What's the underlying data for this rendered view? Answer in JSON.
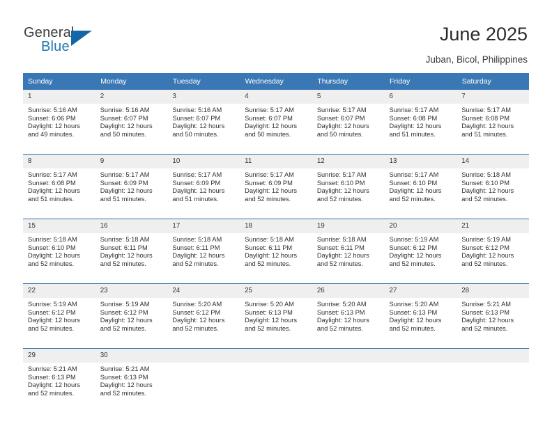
{
  "brand": {
    "name_top": "General",
    "name_bottom": "Blue",
    "accent_color": "#1167a8"
  },
  "header": {
    "title": "June 2025",
    "subtitle": "Juban, Bicol, Philippines"
  },
  "theme": {
    "header_bg": "#3a78b5",
    "week_divider": "#2f6da8",
    "daynum_bg": "#efefef"
  },
  "columns": [
    "Sunday",
    "Monday",
    "Tuesday",
    "Wednesday",
    "Thursday",
    "Friday",
    "Saturday"
  ],
  "labels": {
    "sunrise_prefix": "Sunrise:",
    "sunset_prefix": "Sunset:",
    "daylight_prefix": "Daylight:"
  },
  "weeks": [
    [
      {
        "day": "1",
        "sunrise": "Sunrise: 5:16 AM",
        "sunset": "Sunset: 6:06 PM",
        "daylight1": "Daylight: 12 hours",
        "daylight2": "and 49 minutes."
      },
      {
        "day": "2",
        "sunrise": "Sunrise: 5:16 AM",
        "sunset": "Sunset: 6:07 PM",
        "daylight1": "Daylight: 12 hours",
        "daylight2": "and 50 minutes."
      },
      {
        "day": "3",
        "sunrise": "Sunrise: 5:16 AM",
        "sunset": "Sunset: 6:07 PM",
        "daylight1": "Daylight: 12 hours",
        "daylight2": "and 50 minutes."
      },
      {
        "day": "4",
        "sunrise": "Sunrise: 5:17 AM",
        "sunset": "Sunset: 6:07 PM",
        "daylight1": "Daylight: 12 hours",
        "daylight2": "and 50 minutes."
      },
      {
        "day": "5",
        "sunrise": "Sunrise: 5:17 AM",
        "sunset": "Sunset: 6:07 PM",
        "daylight1": "Daylight: 12 hours",
        "daylight2": "and 50 minutes."
      },
      {
        "day": "6",
        "sunrise": "Sunrise: 5:17 AM",
        "sunset": "Sunset: 6:08 PM",
        "daylight1": "Daylight: 12 hours",
        "daylight2": "and 51 minutes."
      },
      {
        "day": "7",
        "sunrise": "Sunrise: 5:17 AM",
        "sunset": "Sunset: 6:08 PM",
        "daylight1": "Daylight: 12 hours",
        "daylight2": "and 51 minutes."
      }
    ],
    [
      {
        "day": "8",
        "sunrise": "Sunrise: 5:17 AM",
        "sunset": "Sunset: 6:08 PM",
        "daylight1": "Daylight: 12 hours",
        "daylight2": "and 51 minutes."
      },
      {
        "day": "9",
        "sunrise": "Sunrise: 5:17 AM",
        "sunset": "Sunset: 6:09 PM",
        "daylight1": "Daylight: 12 hours",
        "daylight2": "and 51 minutes."
      },
      {
        "day": "10",
        "sunrise": "Sunrise: 5:17 AM",
        "sunset": "Sunset: 6:09 PM",
        "daylight1": "Daylight: 12 hours",
        "daylight2": "and 51 minutes."
      },
      {
        "day": "11",
        "sunrise": "Sunrise: 5:17 AM",
        "sunset": "Sunset: 6:09 PM",
        "daylight1": "Daylight: 12 hours",
        "daylight2": "and 52 minutes."
      },
      {
        "day": "12",
        "sunrise": "Sunrise: 5:17 AM",
        "sunset": "Sunset: 6:10 PM",
        "daylight1": "Daylight: 12 hours",
        "daylight2": "and 52 minutes."
      },
      {
        "day": "13",
        "sunrise": "Sunrise: 5:17 AM",
        "sunset": "Sunset: 6:10 PM",
        "daylight1": "Daylight: 12 hours",
        "daylight2": "and 52 minutes."
      },
      {
        "day": "14",
        "sunrise": "Sunrise: 5:18 AM",
        "sunset": "Sunset: 6:10 PM",
        "daylight1": "Daylight: 12 hours",
        "daylight2": "and 52 minutes."
      }
    ],
    [
      {
        "day": "15",
        "sunrise": "Sunrise: 5:18 AM",
        "sunset": "Sunset: 6:10 PM",
        "daylight1": "Daylight: 12 hours",
        "daylight2": "and 52 minutes."
      },
      {
        "day": "16",
        "sunrise": "Sunrise: 5:18 AM",
        "sunset": "Sunset: 6:11 PM",
        "daylight1": "Daylight: 12 hours",
        "daylight2": "and 52 minutes."
      },
      {
        "day": "17",
        "sunrise": "Sunrise: 5:18 AM",
        "sunset": "Sunset: 6:11 PM",
        "daylight1": "Daylight: 12 hours",
        "daylight2": "and 52 minutes."
      },
      {
        "day": "18",
        "sunrise": "Sunrise: 5:18 AM",
        "sunset": "Sunset: 6:11 PM",
        "daylight1": "Daylight: 12 hours",
        "daylight2": "and 52 minutes."
      },
      {
        "day": "19",
        "sunrise": "Sunrise: 5:18 AM",
        "sunset": "Sunset: 6:11 PM",
        "daylight1": "Daylight: 12 hours",
        "daylight2": "and 52 minutes."
      },
      {
        "day": "20",
        "sunrise": "Sunrise: 5:19 AM",
        "sunset": "Sunset: 6:12 PM",
        "daylight1": "Daylight: 12 hours",
        "daylight2": "and 52 minutes."
      },
      {
        "day": "21",
        "sunrise": "Sunrise: 5:19 AM",
        "sunset": "Sunset: 6:12 PM",
        "daylight1": "Daylight: 12 hours",
        "daylight2": "and 52 minutes."
      }
    ],
    [
      {
        "day": "22",
        "sunrise": "Sunrise: 5:19 AM",
        "sunset": "Sunset: 6:12 PM",
        "daylight1": "Daylight: 12 hours",
        "daylight2": "and 52 minutes."
      },
      {
        "day": "23",
        "sunrise": "Sunrise: 5:19 AM",
        "sunset": "Sunset: 6:12 PM",
        "daylight1": "Daylight: 12 hours",
        "daylight2": "and 52 minutes."
      },
      {
        "day": "24",
        "sunrise": "Sunrise: 5:20 AM",
        "sunset": "Sunset: 6:12 PM",
        "daylight1": "Daylight: 12 hours",
        "daylight2": "and 52 minutes."
      },
      {
        "day": "25",
        "sunrise": "Sunrise: 5:20 AM",
        "sunset": "Sunset: 6:13 PM",
        "daylight1": "Daylight: 12 hours",
        "daylight2": "and 52 minutes."
      },
      {
        "day": "26",
        "sunrise": "Sunrise: 5:20 AM",
        "sunset": "Sunset: 6:13 PM",
        "daylight1": "Daylight: 12 hours",
        "daylight2": "and 52 minutes."
      },
      {
        "day": "27",
        "sunrise": "Sunrise: 5:20 AM",
        "sunset": "Sunset: 6:13 PM",
        "daylight1": "Daylight: 12 hours",
        "daylight2": "and 52 minutes."
      },
      {
        "day": "28",
        "sunrise": "Sunrise: 5:21 AM",
        "sunset": "Sunset: 6:13 PM",
        "daylight1": "Daylight: 12 hours",
        "daylight2": "and 52 minutes."
      }
    ],
    [
      {
        "day": "29",
        "sunrise": "Sunrise: 5:21 AM",
        "sunset": "Sunset: 6:13 PM",
        "daylight1": "Daylight: 12 hours",
        "daylight2": "and 52 minutes."
      },
      {
        "day": "30",
        "sunrise": "Sunrise: 5:21 AM",
        "sunset": "Sunset: 6:13 PM",
        "daylight1": "Daylight: 12 hours",
        "daylight2": "and 52 minutes."
      },
      {
        "day": "",
        "sunrise": "",
        "sunset": "",
        "daylight1": "",
        "daylight2": "",
        "empty": true
      },
      {
        "day": "",
        "sunrise": "",
        "sunset": "",
        "daylight1": "",
        "daylight2": "",
        "empty": true
      },
      {
        "day": "",
        "sunrise": "",
        "sunset": "",
        "daylight1": "",
        "daylight2": "",
        "empty": true
      },
      {
        "day": "",
        "sunrise": "",
        "sunset": "",
        "daylight1": "",
        "daylight2": "",
        "empty": true
      },
      {
        "day": "",
        "sunrise": "",
        "sunset": "",
        "daylight1": "",
        "daylight2": "",
        "empty": true
      }
    ]
  ]
}
